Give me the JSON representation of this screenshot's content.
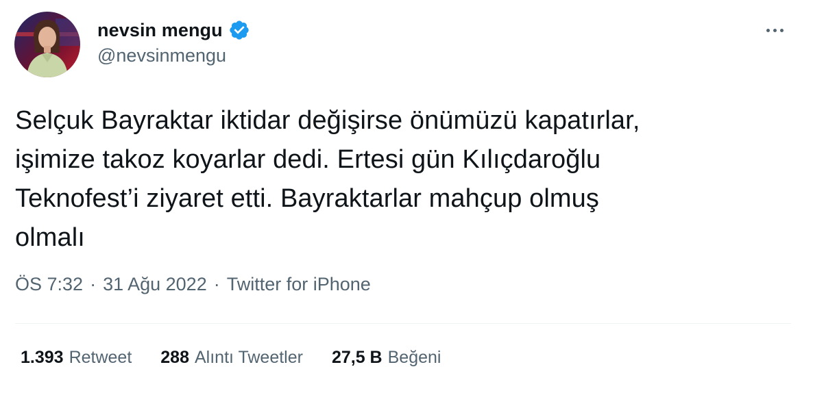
{
  "author": {
    "display_name": "nevsin mengu",
    "handle": "@nevsinmengu",
    "verified": true,
    "verified_color": "#1d9bf0"
  },
  "tweet": {
    "text": "Selçuk Bayraktar iktidar değişirse önümüzü kapatırlar,\nişimize takoz koyarlar dedi. Ertesi gün Kılıçdaroğlu\nTeknofest’i ziyaret etti. Bayraktarlar mahçup olmuş\nolmalı"
  },
  "meta": {
    "time": "ÖS 7:32",
    "separator": "·",
    "date": "31 Ağu 2022",
    "source": "Twitter for iPhone"
  },
  "stats": {
    "retweets": {
      "count": "1.393",
      "label": "Retweet"
    },
    "quotes": {
      "count": "288",
      "label": "Alıntı Tweetler"
    },
    "likes": {
      "count": "27,5 B",
      "label": "Beğeni"
    }
  },
  "icons": {
    "verified": "verified-badge-icon",
    "more": "more-options-icon"
  },
  "colors": {
    "text_primary": "#0f1419",
    "text_secondary": "#536471",
    "divider": "#eff3f4",
    "accent": "#1d9bf0"
  }
}
